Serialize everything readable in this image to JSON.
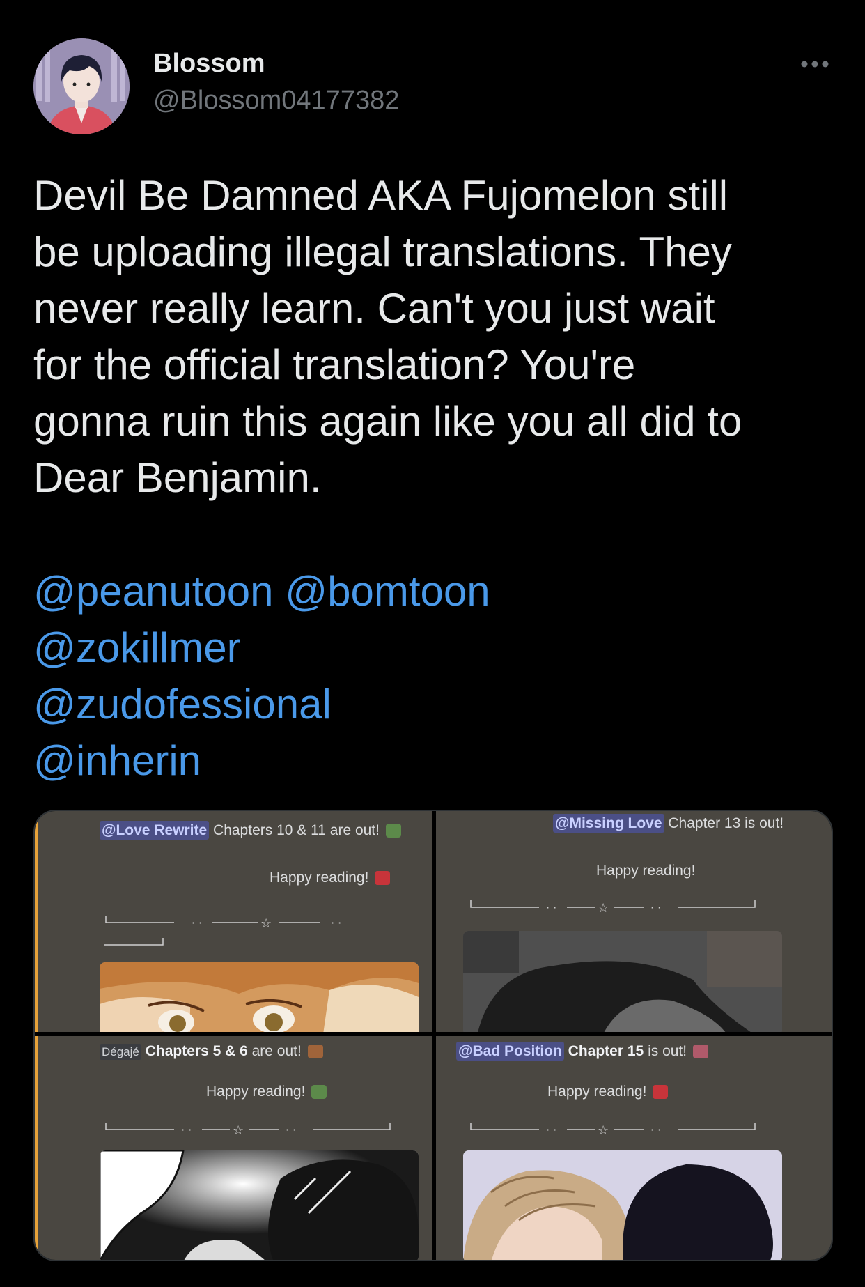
{
  "author": {
    "name": "Blossom",
    "handle": "@Blossom04177382"
  },
  "menu_icon": "more-horizontal-icon",
  "tweet": {
    "text": "Devil Be Damned AKA Fujomelon still\nbe uploading illegal translations. They\nnever really learn. Can't you just wait\nfor the official translation? You're\ngonna ruin this again like you all did to\nDear Benjamin.",
    "mention_lines": [
      "@peanutoon @bomtoon",
      "@zokillmer",
      "@zudofessional",
      "@inherin"
    ]
  },
  "link_color": "#4a99e9",
  "media": {
    "panels": [
      {
        "channel": "@Love Rewrite",
        "announcement": "Chapters 10 & 11",
        "suffix": "are out!",
        "happy": "Happy reading!"
      },
      {
        "channel": "@Missing Love",
        "announcement": "Chapter 13 is out!",
        "suffix": "",
        "happy": "Happy reading!"
      },
      {
        "channel": "Dégajé",
        "announcement": "Chapters 5 & 6",
        "suffix": "are out!",
        "happy": "Happy reading!"
      },
      {
        "channel": "@Bad Position",
        "announcement": "Chapter 15",
        "suffix": "is out!",
        "happy": "Happy reading!"
      }
    ]
  }
}
